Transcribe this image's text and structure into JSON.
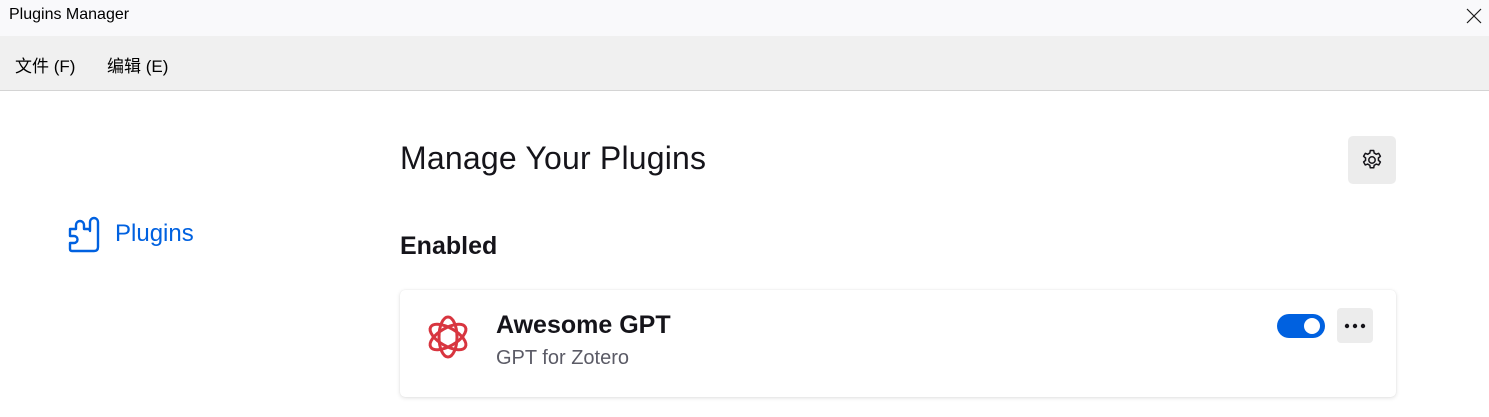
{
  "window": {
    "title": "Plugins Manager",
    "close_icon": "close-icon"
  },
  "menubar": {
    "items": [
      {
        "label": "文件 (F)"
      },
      {
        "label": "编辑 (E)"
      }
    ]
  },
  "sidebar": {
    "items": [
      {
        "label": "Plugins",
        "icon": "puzzle-piece-icon",
        "selected": true
      }
    ]
  },
  "main": {
    "heading": "Manage Your Plugins",
    "settings_icon": "gear-icon",
    "sections": [
      {
        "heading": "Enabled",
        "plugins": [
          {
            "name": "Awesome GPT",
            "description": "GPT for Zotero",
            "icon": "openai-logo-icon",
            "enabled": true,
            "more_icon": "more-options-icon"
          }
        ]
      }
    ]
  },
  "colors": {
    "accent": "#0061e0",
    "plugin_logo": "#d8353f",
    "menubar_bg": "#f0f0f0"
  }
}
